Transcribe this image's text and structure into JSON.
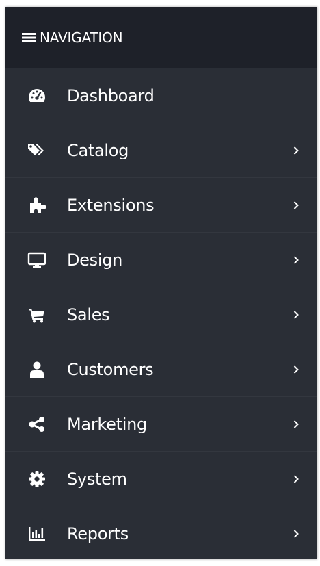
{
  "header": {
    "title": "NAVIGATION",
    "icon": "hamburger-menu-icon"
  },
  "colors": {
    "panel_bg": "#2a2e36",
    "header_bg": "#1e2129",
    "divider": "#33373f",
    "text": "#ffffff"
  },
  "menu": {
    "items": [
      {
        "label": "Dashboard",
        "icon": "dashboard-gauge-icon",
        "has_submenu": false
      },
      {
        "label": "Catalog",
        "icon": "tags-icon",
        "has_submenu": true
      },
      {
        "label": "Extensions",
        "icon": "puzzle-piece-icon",
        "has_submenu": true
      },
      {
        "label": "Design",
        "icon": "monitor-icon",
        "has_submenu": true
      },
      {
        "label": "Sales",
        "icon": "shopping-cart-icon",
        "has_submenu": true
      },
      {
        "label": "Customers",
        "icon": "user-icon",
        "has_submenu": true
      },
      {
        "label": "Marketing",
        "icon": "share-icon",
        "has_submenu": true
      },
      {
        "label": "System",
        "icon": "cog-icon",
        "has_submenu": true
      },
      {
        "label": "Reports",
        "icon": "bar-chart-icon",
        "has_submenu": true
      }
    ]
  }
}
